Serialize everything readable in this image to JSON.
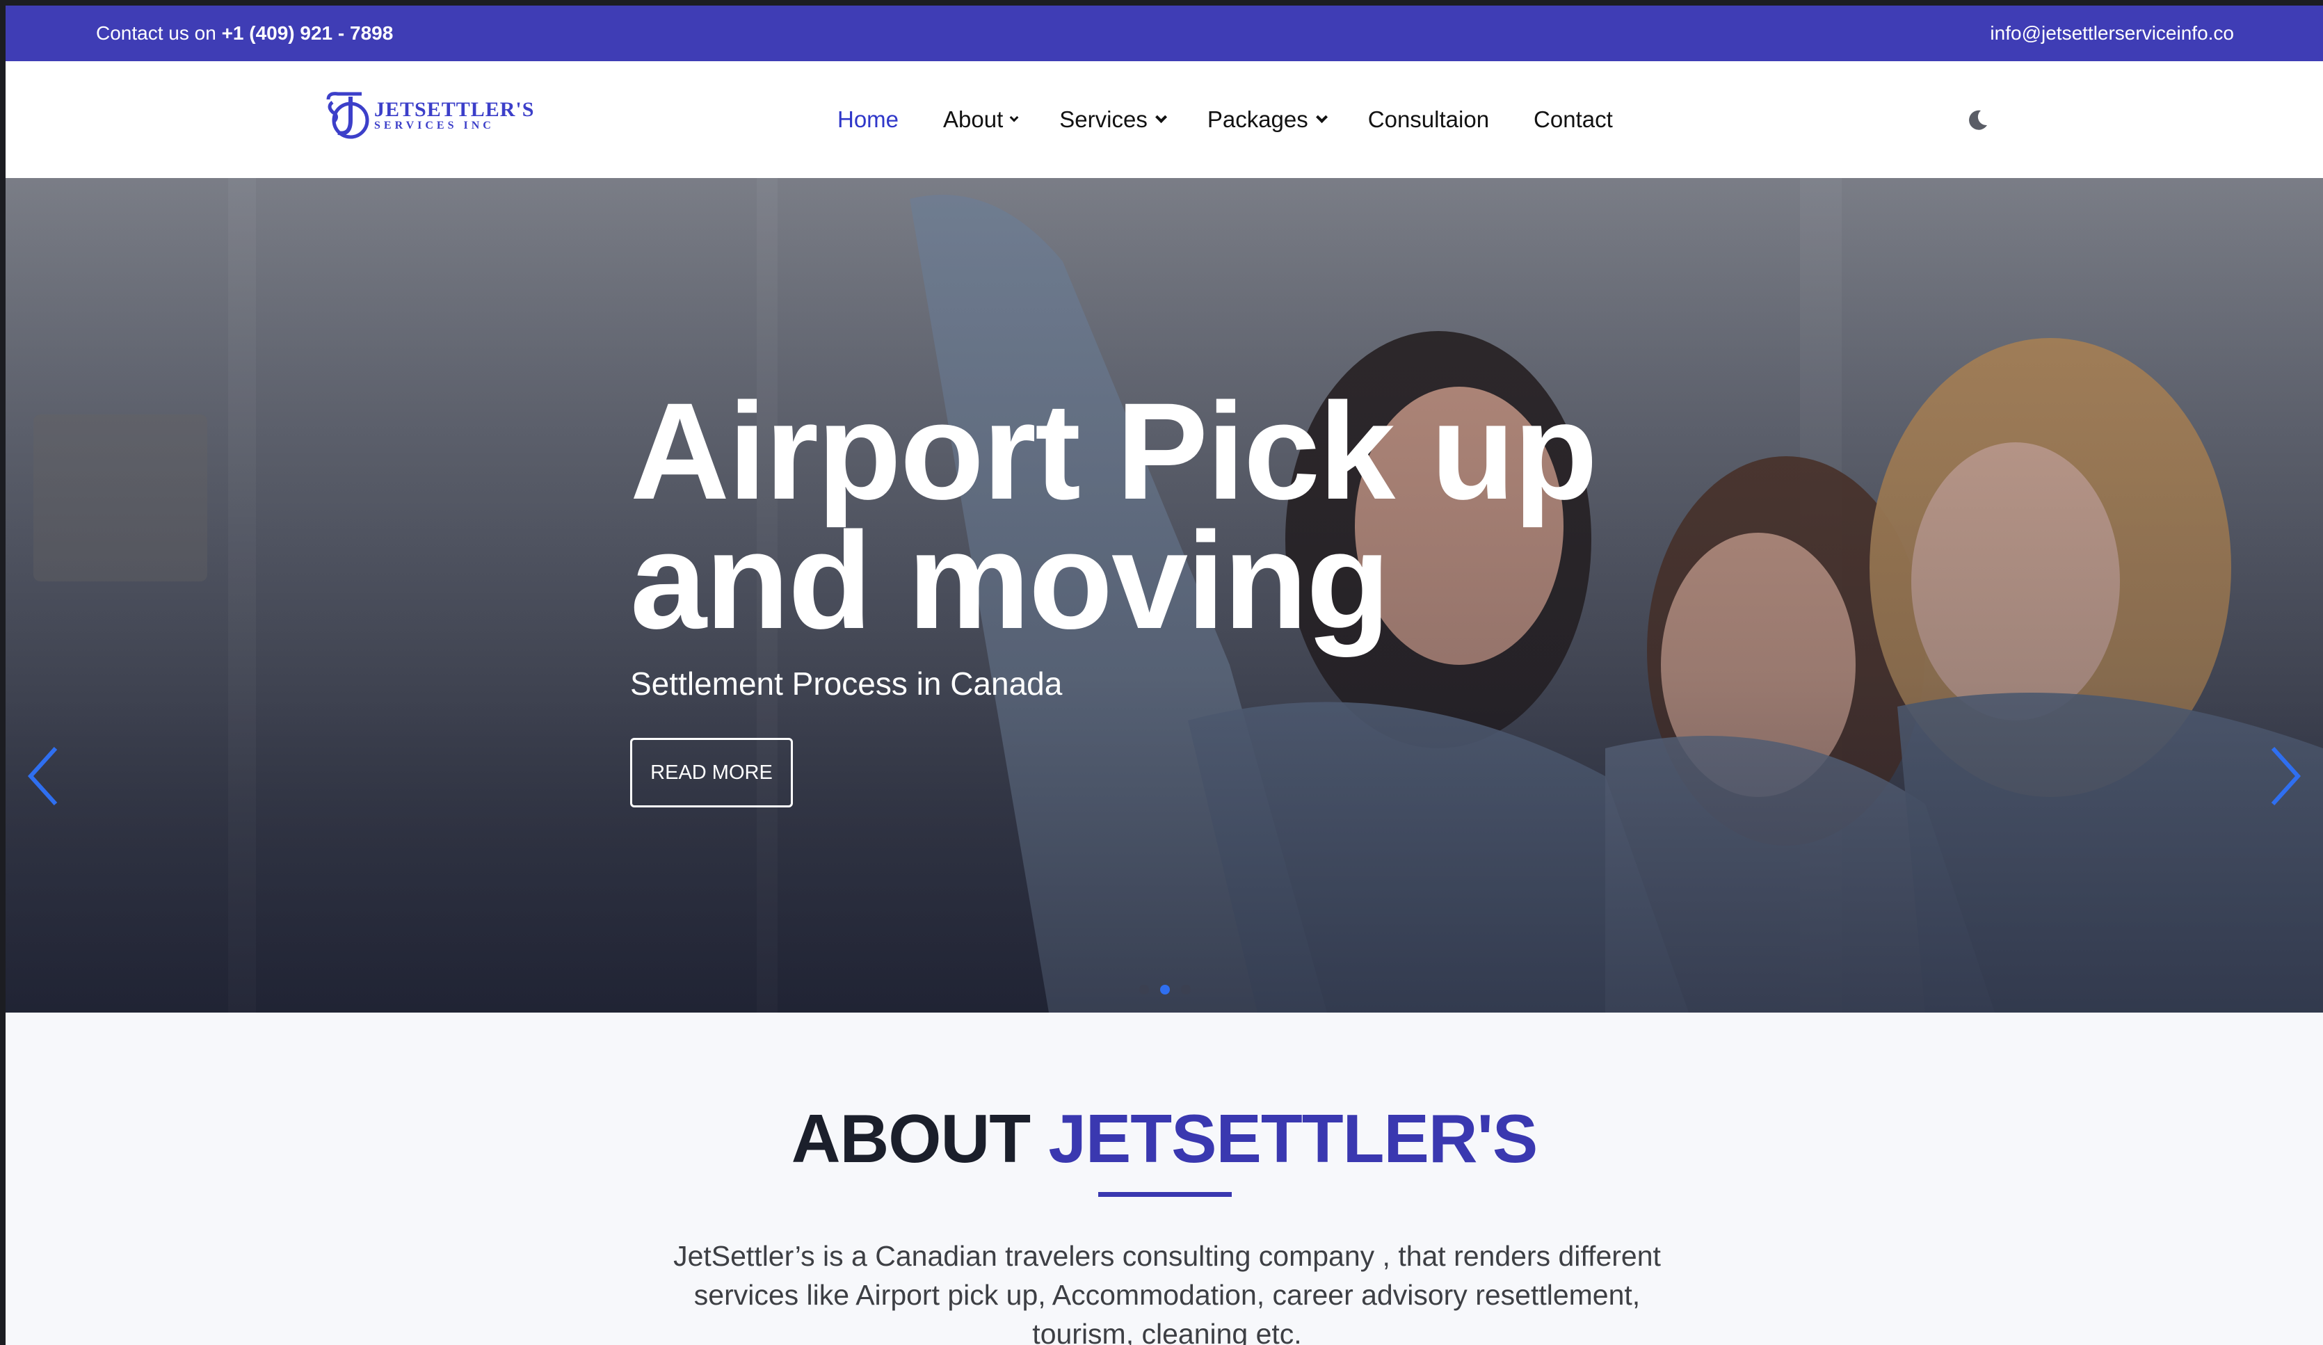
{
  "topbar": {
    "contact_prefix": "Contact us on",
    "phone": "+1 (409) 921 - 7898",
    "email": "info@jetsettlerserviceinfo.co"
  },
  "logo": {
    "line1": "JETSETTLER'S",
    "line2": "SERVICES INC"
  },
  "nav": {
    "items": [
      {
        "label": "Home",
        "active": true
      },
      {
        "label": "About"
      },
      {
        "label": "Services"
      },
      {
        "label": "Packages"
      },
      {
        "label": "Consultaion"
      },
      {
        "label": "Contact"
      }
    ],
    "theme_toggle_icon": "moon-icon"
  },
  "hero": {
    "title_line1": "Airport Pick up",
    "title_line2": "and moving",
    "subtitle": "Settlement Process in Canada",
    "button": "READ MORE",
    "prev_icon": "chevron-left-icon",
    "next_icon": "chevron-right-icon",
    "active_slide": 2,
    "slide_count": 3
  },
  "about": {
    "title_plain": "ABOUT",
    "title_accent": "JETSETTLER'S",
    "body": "JetSettler’s is a Canadian travelers consulting company , that renders different services like Airport pick up, Accommodation, career advisory resettlement, tourism, cleaning etc."
  },
  "colors": {
    "brand": "#3f3db5",
    "accent_text": "#3a38b0",
    "slider_arrow": "#2f6ff0"
  }
}
